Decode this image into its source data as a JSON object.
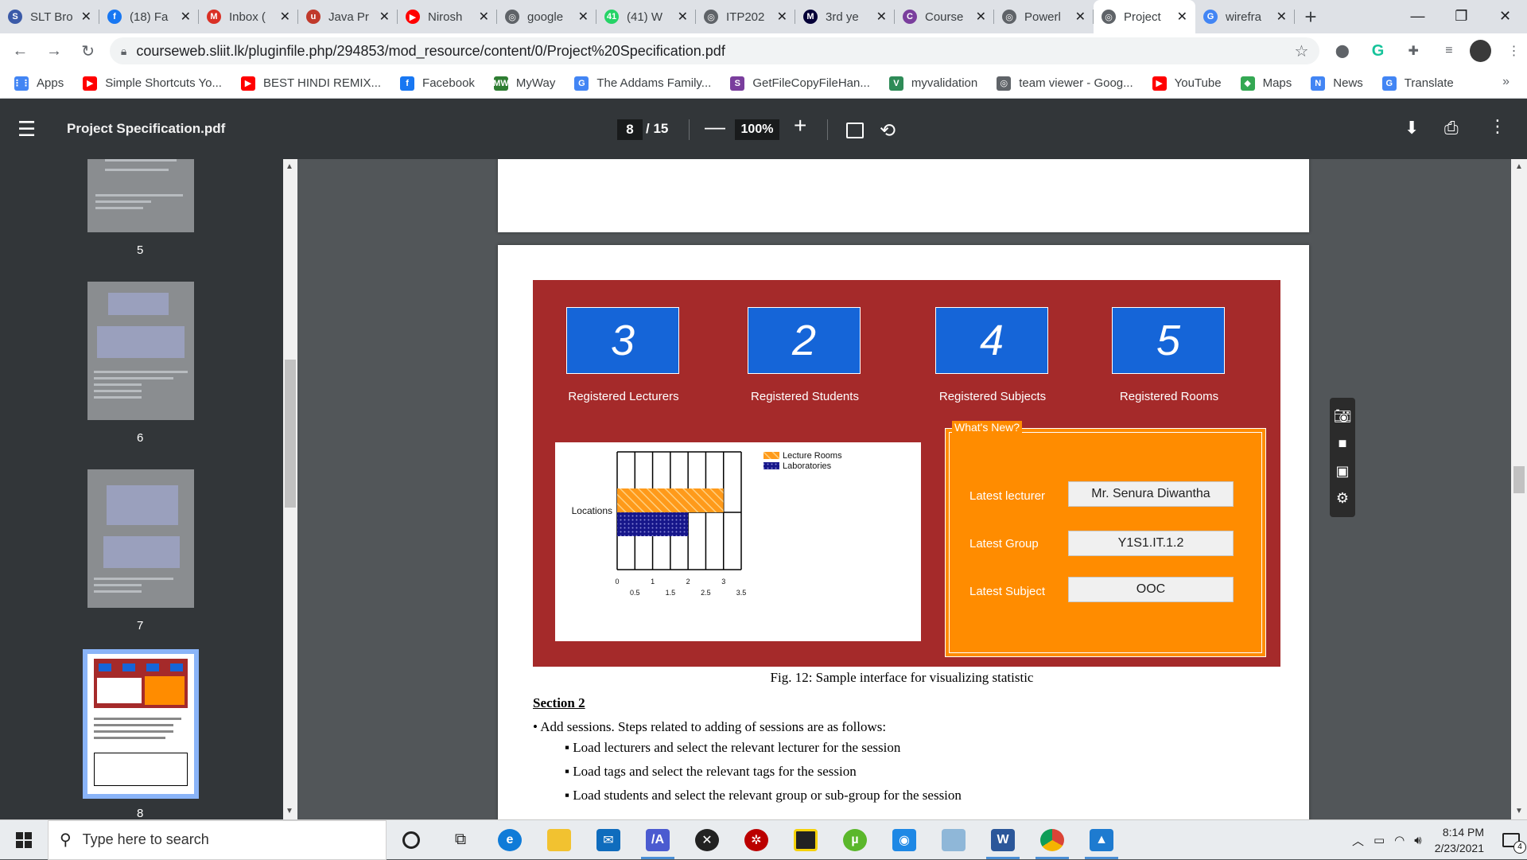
{
  "browser": {
    "tabs": [
      {
        "title": "SLT Bro",
        "icon": "slt-icon",
        "color": "#3b5aa8",
        "glyph": "S"
      },
      {
        "title": "(18) Fa",
        "icon": "facebook-icon",
        "color": "#1877f2",
        "glyph": "f"
      },
      {
        "title": "Inbox (",
        "icon": "gmail-icon",
        "color": "#d93025",
        "glyph": "M"
      },
      {
        "title": "Java Pr",
        "icon": "udemy-icon",
        "color": "#c0392b",
        "glyph": "u"
      },
      {
        "title": "Nirosh",
        "icon": "youtube-icon",
        "color": "#ff0000",
        "glyph": "▶"
      },
      {
        "title": "google",
        "icon": "globe-icon",
        "color": "#5f6368",
        "glyph": "◎"
      },
      {
        "title": "(41) W",
        "icon": "whatsapp-icon",
        "color": "#25d366",
        "glyph": "41"
      },
      {
        "title": "ITP202",
        "icon": "globe-icon",
        "color": "#5f6368",
        "glyph": "◎"
      },
      {
        "title": "3rd ye",
        "icon": "miro-icon",
        "color": "#050038",
        "glyph": "M"
      },
      {
        "title": "Course",
        "icon": "sliit-icon",
        "color": "#7a3e9d",
        "glyph": "C"
      },
      {
        "title": "Powerl",
        "icon": "globe-icon",
        "color": "#5f6368",
        "glyph": "◎"
      },
      {
        "title": "Project",
        "icon": "globe-icon",
        "color": "#5f6368",
        "glyph": "◎",
        "active": true
      },
      {
        "title": "wirefra",
        "icon": "google-icon",
        "color": "#4285f4",
        "glyph": "G"
      }
    ],
    "url": "courseweb.sliit.lk/pluginfile.php/294853/mod_resource/content/0/Project%20Specification.pdf",
    "bookmarks": [
      {
        "label": "Apps",
        "icon": "apps-grid-icon",
        "color": "#4285f4",
        "glyph": "⋮⋮"
      },
      {
        "label": "Simple Shortcuts Yo...",
        "icon": "youtube-icon",
        "color": "#ff0000",
        "glyph": "▶"
      },
      {
        "label": "BEST HINDI REMIX...",
        "icon": "youtube-icon",
        "color": "#ff0000",
        "glyph": "▶"
      },
      {
        "label": "Facebook",
        "icon": "facebook-icon",
        "color": "#1877f2",
        "glyph": "f"
      },
      {
        "label": "MyWay",
        "icon": "myway-icon",
        "color": "#2e7d32",
        "glyph": "MW"
      },
      {
        "label": "The Addams Family...",
        "icon": "google-icon",
        "color": "#4285f4",
        "glyph": "G"
      },
      {
        "label": "GetFileCopyFileHan...",
        "icon": "sliit-icon",
        "color": "#7a3e9d",
        "glyph": "S"
      },
      {
        "label": "myvalidation",
        "icon": "v-icon",
        "color": "#2e8b57",
        "glyph": "V"
      },
      {
        "label": "team viewer - Goog...",
        "icon": "globe-icon",
        "color": "#5f6368",
        "glyph": "◎"
      },
      {
        "label": "YouTube",
        "icon": "youtube-icon",
        "color": "#ff0000",
        "glyph": "▶"
      },
      {
        "label": "Maps",
        "icon": "maps-icon",
        "color": "#34a853",
        "glyph": "◆"
      },
      {
        "label": "News",
        "icon": "news-icon",
        "color": "#4285f4",
        "glyph": "N"
      },
      {
        "label": "Translate",
        "icon": "translate-icon",
        "color": "#4285f4",
        "glyph": "G"
      }
    ]
  },
  "pdf": {
    "title": "Project Specification.pdf",
    "current_page": "8",
    "total_pages": "/ 15",
    "zoom": "100%"
  },
  "thumbnails": [
    {
      "number": "5"
    },
    {
      "number": "6"
    },
    {
      "number": "7"
    },
    {
      "number": "8"
    }
  ],
  "figure": {
    "stats": [
      {
        "value": "3",
        "label": "Registered Lecturers"
      },
      {
        "value": "2",
        "label": "Registered Students"
      },
      {
        "value": "4",
        "label": "Registered Subjects"
      },
      {
        "value": "5",
        "label": "Registered Rooms"
      }
    ],
    "whats_new_title": "What's New?",
    "whats_new": [
      {
        "label": "Latest lecturer",
        "value": "Mr. Senura Diwantha"
      },
      {
        "label": "Latest Group",
        "value": "Y1S1.IT.1.2"
      },
      {
        "label": "Latest Subject",
        "value": "OOC"
      }
    ],
    "caption": "Fig. 12: Sample interface for visualizing statistic"
  },
  "chart_data": {
    "type": "bar",
    "orientation": "horizontal",
    "categories": [
      "Locations"
    ],
    "series": [
      {
        "name": "Lecture Rooms",
        "values": [
          3
        ],
        "color": "#ff9a1a"
      },
      {
        "name": "Laboratories",
        "values": [
          2
        ],
        "color": "#1a1a8c"
      }
    ],
    "xlim": [
      0,
      3.5
    ],
    "ticks_major": [
      "0",
      "1",
      "2",
      "3"
    ],
    "ticks_minor": [
      "0.5",
      "1.5",
      "2.5",
      "3.5"
    ],
    "legend": "top-right",
    "grid": true
  },
  "document": {
    "section": "Section 2",
    "bullet": "Add sessions. Steps related to adding of sessions are as follows:",
    "subbullets": [
      "Load lecturers and select the relevant lecturer for the session",
      "Load tags and select the relevant tags for the session",
      "Load students and select the relevant group or sub-group for the session"
    ]
  },
  "taskbar": {
    "search_placeholder": "Type here to search",
    "time": "8:14 PM",
    "date": "2/23/2021",
    "notification_count": "4"
  }
}
